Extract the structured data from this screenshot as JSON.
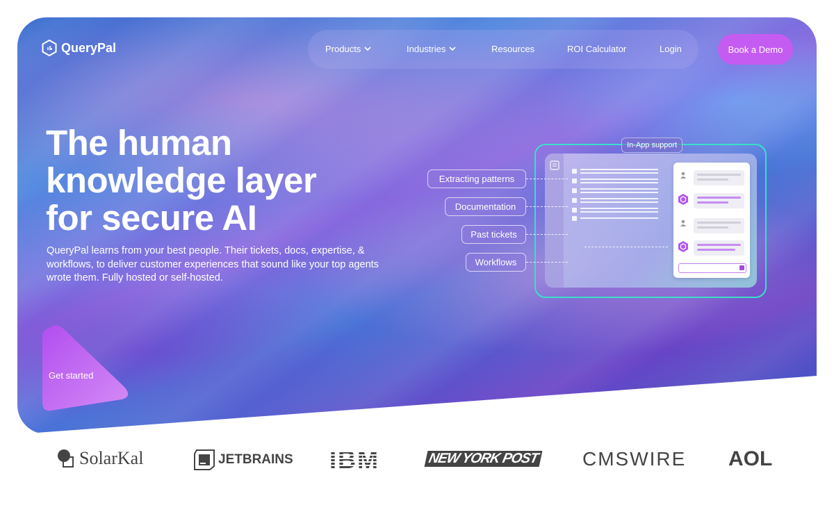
{
  "brand": {
    "name": "QueryPal"
  },
  "nav": {
    "items": [
      {
        "label": "Products",
        "has_dropdown": true
      },
      {
        "label": "Industries",
        "has_dropdown": true
      },
      {
        "label": "Resources",
        "has_dropdown": false
      },
      {
        "label": "ROI Calculator",
        "has_dropdown": false
      },
      {
        "label": "Login",
        "has_dropdown": false
      }
    ],
    "cta_label": "Book a Demo"
  },
  "hero": {
    "headline_lines": [
      "The human",
      "knowledge layer",
      "for secure AI"
    ],
    "subtext": "QueryPal learns from your best people. Their tickets, docs, expertise, & workflows, to deliver customer experiences that sound like your top agents wrote them. Fully hosted or self-hosted.",
    "cta_label": "Get started"
  },
  "illustration": {
    "frame_label": "In-App support",
    "sources": [
      "Extracting patterns",
      "Documentation",
      "Past tickets",
      "Workflows"
    ]
  },
  "client_logos": [
    "SolarKal",
    "JETBRAINS",
    "IBM",
    "NEW YORK POST",
    "CMSWIRE",
    "AOL"
  ],
  "colors": {
    "accent": "#c55cf2",
    "frame": "#39e0c8",
    "logo_gray": "#444444"
  }
}
